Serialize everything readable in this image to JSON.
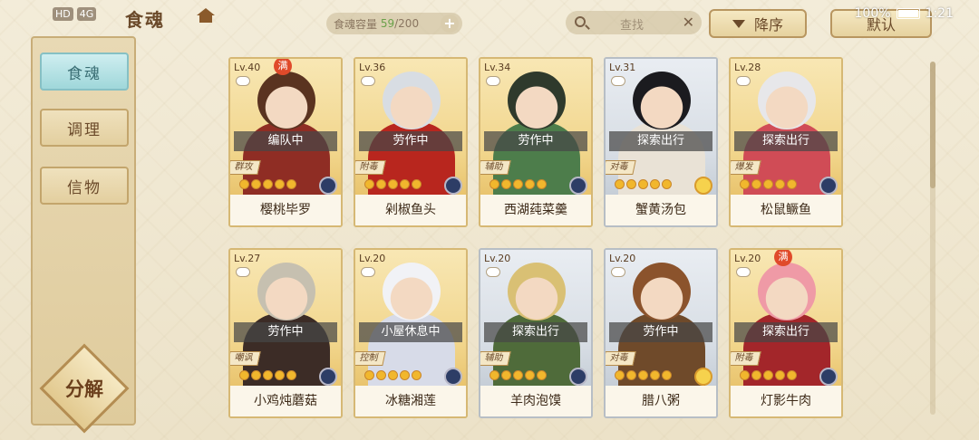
{
  "status_bar": {
    "left_icons": [
      "HD",
      "4G",
      "signal-icon",
      "wifi-icon"
    ],
    "battery": "100%",
    "time": "1:21"
  },
  "header": {
    "title": "食魂",
    "capacity_label": "食魂容量",
    "capacity_current": "59",
    "capacity_max": "/200",
    "search_placeholder": "查找",
    "sort_label": "降序",
    "default_label": "默认"
  },
  "sidebar": {
    "tabs": [
      {
        "label": "食魂",
        "active": true
      },
      {
        "label": "调理",
        "active": false
      },
      {
        "label": "信物",
        "active": false
      }
    ],
    "decompose_label": "分解"
  },
  "cards": [
    {
      "lv": "Lv.40",
      "full": "满",
      "status": "编队中",
      "role": "群攻",
      "name": "樱桃毕罗",
      "frame": "gold",
      "element": "dark",
      "stars": 5,
      "filled": 5,
      "hair": "#5a3320",
      "robe": "#8f2d24"
    },
    {
      "lv": "Lv.36",
      "full": "",
      "status": "劳作中",
      "role": "附毒",
      "name": "剁椒鱼头",
      "frame": "gold",
      "element": "dark",
      "stars": 5,
      "filled": 5,
      "hair": "#d8dde3",
      "robe": "#b8261e"
    },
    {
      "lv": "Lv.34",
      "full": "",
      "status": "劳作中",
      "role": "辅助",
      "name": "西湖莼菜羹",
      "frame": "gold",
      "element": "dark",
      "stars": 5,
      "filled": 5,
      "hair": "#2f3a2c",
      "robe": "#4d7d4b"
    },
    {
      "lv": "Lv.31",
      "full": "",
      "status": "探索出行",
      "role": "对毒",
      "name": "蟹黄汤包",
      "frame": "silver",
      "element": "yellow",
      "stars": 5,
      "filled": 5,
      "hair": "#1b1b1f",
      "robe": "#e9e2d6"
    },
    {
      "lv": "Lv.28",
      "full": "",
      "status": "探索出行",
      "role": "爆发",
      "name": "松鼠鳜鱼",
      "frame": "gold",
      "element": "dark",
      "stars": 5,
      "filled": 5,
      "hair": "#e7e7ea",
      "robe": "#d04c56"
    },
    {
      "lv": "Lv.27",
      "full": "",
      "status": "劳作中",
      "role": "嘲讽",
      "name": "小鸡炖蘑菇",
      "frame": "gold",
      "element": "dark",
      "stars": 5,
      "filled": 5,
      "hair": "#c6c0b0",
      "robe": "#3c2c26"
    },
    {
      "lv": "Lv.20",
      "full": "",
      "status": "小屋休息中",
      "role": "控制",
      "name": "冰糖湘莲",
      "frame": "gold",
      "element": "dark",
      "stars": 5,
      "filled": 5,
      "hair": "#f1f2f6",
      "robe": "#d7dbe8"
    },
    {
      "lv": "Lv.20",
      "full": "",
      "status": "探索出行",
      "role": "辅助",
      "name": "羊肉泡馍",
      "frame": "silver",
      "element": "dark",
      "stars": 5,
      "filled": 5,
      "hair": "#d9c074",
      "robe": "#4f6b3a"
    },
    {
      "lv": "Lv.20",
      "full": "",
      "status": "劳作中",
      "role": "对毒",
      "name": "腊八粥",
      "frame": "silver",
      "element": "yellow",
      "stars": 5,
      "filled": 5,
      "hair": "#8b532c",
      "robe": "#6f4a2a"
    },
    {
      "lv": "Lv.20",
      "full": "满",
      "status": "探索出行",
      "role": "附毒",
      "name": "灯影牛肉",
      "frame": "gold",
      "element": "dark",
      "stars": 5,
      "filled": 5,
      "hair": "#ef9aa6",
      "robe": "#a3262a"
    }
  ]
}
